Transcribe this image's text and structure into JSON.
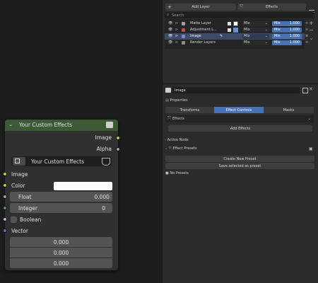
{
  "layers_panel": {
    "add_layer_label": "Add Layer",
    "effects_label": "Effects",
    "search_placeholder": "Search",
    "rows": [
      {
        "name": "Matte Layer",
        "blend": "Mix",
        "value_label": "Mix",
        "value": "1.000",
        "swatch": "#a0a0a0",
        "selected": false
      },
      {
        "name": "Adjustment L...",
        "blend": "Mix",
        "value_label": "Mix",
        "value": "1.000",
        "swatch": "#c94a3a",
        "selected": false
      },
      {
        "name": "Image",
        "blend": "Mix",
        "value_label": "Mix",
        "value": "1.000",
        "swatch": "#6a8fc8",
        "selected": true
      },
      {
        "name": "Render Layers",
        "blend": "Mix",
        "value_label": "Mix",
        "value": "1.000",
        "swatch": "#8a8a8a",
        "selected": false
      }
    ]
  },
  "image_panel": {
    "name_value": "Image",
    "properties_label": "Properties",
    "tabs": [
      "Transforms",
      "Effect Controls",
      "Masks"
    ],
    "active_tab": "Effect Controls",
    "effects_dropdown": "Effects",
    "add_effects_label": "Add Effects",
    "active_node_label": "Active Node",
    "effect_presets_label": "Effect Presets",
    "create_preset_label": "Create New Preset",
    "save_preset_label": "Save selected as preset",
    "no_presets_label": "No Presets"
  },
  "node": {
    "title": "Your Custom Effects",
    "header_color": "#3b5b34",
    "outputs": [
      {
        "label": "Image",
        "color": "#c7c729"
      },
      {
        "label": "Alpha",
        "color": "#a1a1a1"
      }
    ],
    "group_name": "Your Custom Effects",
    "inputs": {
      "image_label": "Image",
      "color_label": "Color",
      "color_value": "#ffffff",
      "float_label": "Float",
      "float_value": "0.000",
      "integer_label": "Integer",
      "integer_value": "0",
      "boolean_label": "Boolean",
      "vector_label": "Vector",
      "vector_values": [
        "0.000",
        "0.000",
        "0.000"
      ]
    },
    "socket_colors": {
      "image": "#c7c729",
      "color": "#c7c729",
      "float": "#a1a1a1",
      "integer": "#598c5c",
      "boolean": "#cca6d6",
      "vector": "#6363c7"
    }
  }
}
